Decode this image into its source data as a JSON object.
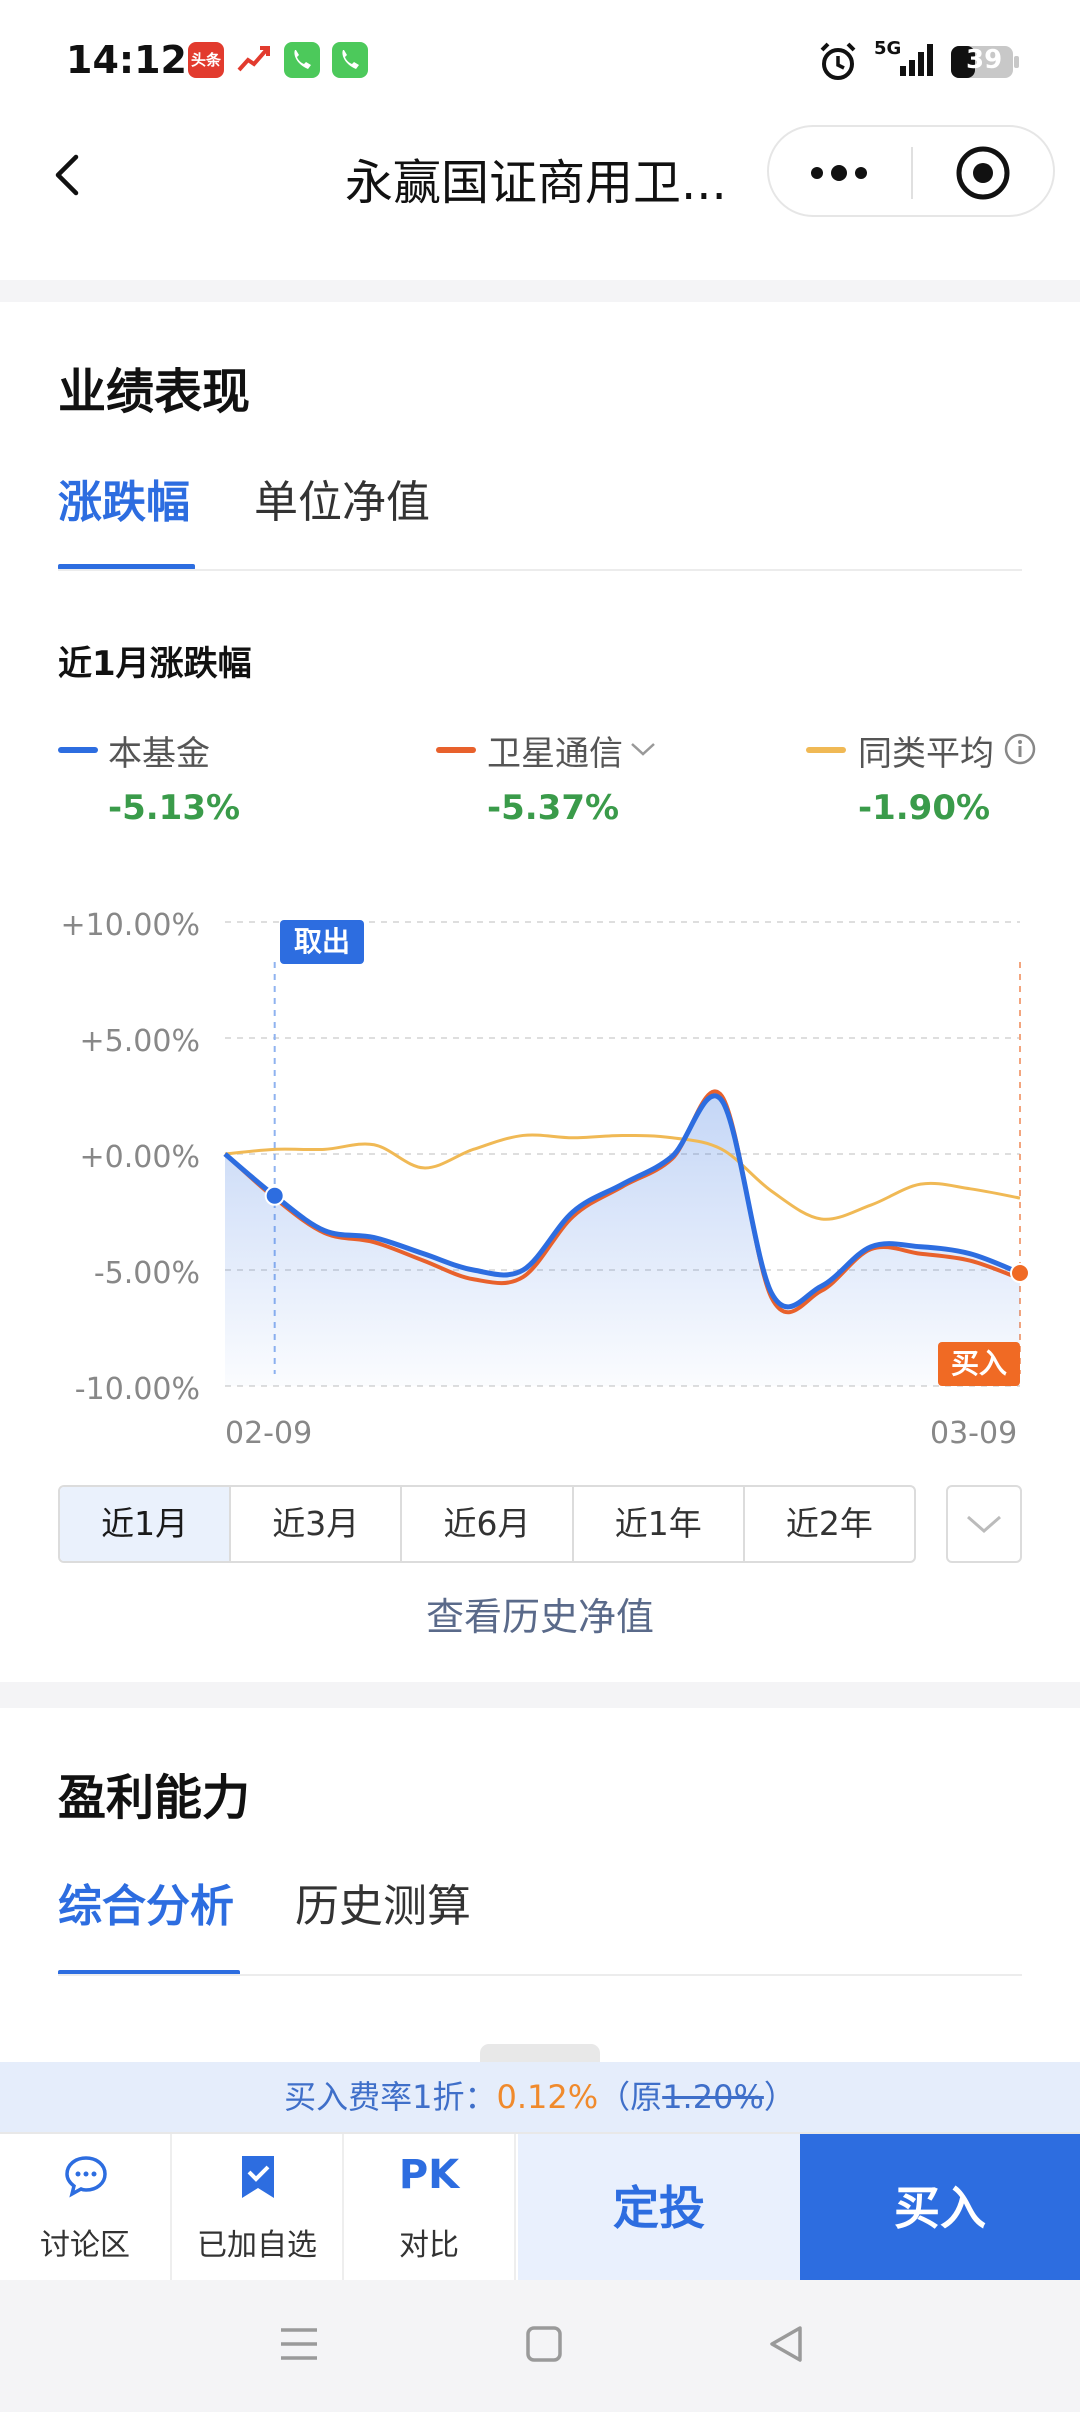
{
  "status": {
    "time": "14:12",
    "notif1": "头条",
    "battery": "39",
    "network": "5G"
  },
  "header": {
    "title": "永赢国证商用卫..."
  },
  "performance": {
    "section_title": "业绩表现",
    "tabs": [
      "涨跌幅",
      "单位净值"
    ],
    "period_title": "近1月涨跌幅",
    "legend": [
      {
        "label": "本基金",
        "value": "-5.13%",
        "color": "#2d6de0"
      },
      {
        "label": "卫星通信",
        "value": "-5.37%",
        "color": "#e8612c"
      },
      {
        "label": "同类平均",
        "value": "-1.90%",
        "color": "#f0b955"
      }
    ],
    "sell_marker": "取出",
    "buy_marker": "买入",
    "ranges": [
      "近1月",
      "近3月",
      "近6月",
      "近1年",
      "近2年"
    ],
    "history_link": "查看历史净值"
  },
  "chart_data": {
    "type": "line",
    "yticks": [
      "+10.00%",
      "+5.00%",
      "+0.00%",
      "-5.00%",
      "-10.00%"
    ],
    "ylim": [
      -10,
      10
    ],
    "x_start": "02-09",
    "x_end": "03-09",
    "series": [
      {
        "name": "本基金",
        "color": "#2d6de0",
        "values": [
          0,
          -1.8,
          -3.3,
          -3.6,
          -4.3,
          -5.0,
          -5.0,
          -2.5,
          -1.3,
          -0.1,
          2.3,
          -6.0,
          -5.7,
          -4.0,
          -4.0,
          -4.3,
          -5.13
        ]
      },
      {
        "name": "卫星通信",
        "color": "#e8612c",
        "values": [
          0,
          -1.9,
          -3.4,
          -3.8,
          -4.6,
          -5.4,
          -5.3,
          -2.7,
          -1.4,
          -0.2,
          2.5,
          -6.2,
          -5.9,
          -4.1,
          -4.3,
          -4.6,
          -5.37
        ]
      },
      {
        "name": "同类平均",
        "color": "#f0b955",
        "values": [
          0,
          0.2,
          0.2,
          0.4,
          -0.6,
          0.2,
          0.8,
          0.7,
          0.8,
          0.7,
          0.2,
          -1.6,
          -2.8,
          -2.2,
          -1.3,
          -1.5,
          -1.9
        ]
      }
    ]
  },
  "profit": {
    "section_title": "盈利能力",
    "tabs": [
      "综合分析",
      "历史测算"
    ]
  },
  "fee": {
    "prefix": "买入费率1折：",
    "price": "0.12%",
    "orig_open": "（原",
    "orig_rate": "1.20%",
    "orig_close": "）"
  },
  "bottom": {
    "discuss": "讨论区",
    "watch": "已加自选",
    "pk_icon": "PK",
    "compare": "对比",
    "dingtou": "定投",
    "buy": "买入"
  }
}
